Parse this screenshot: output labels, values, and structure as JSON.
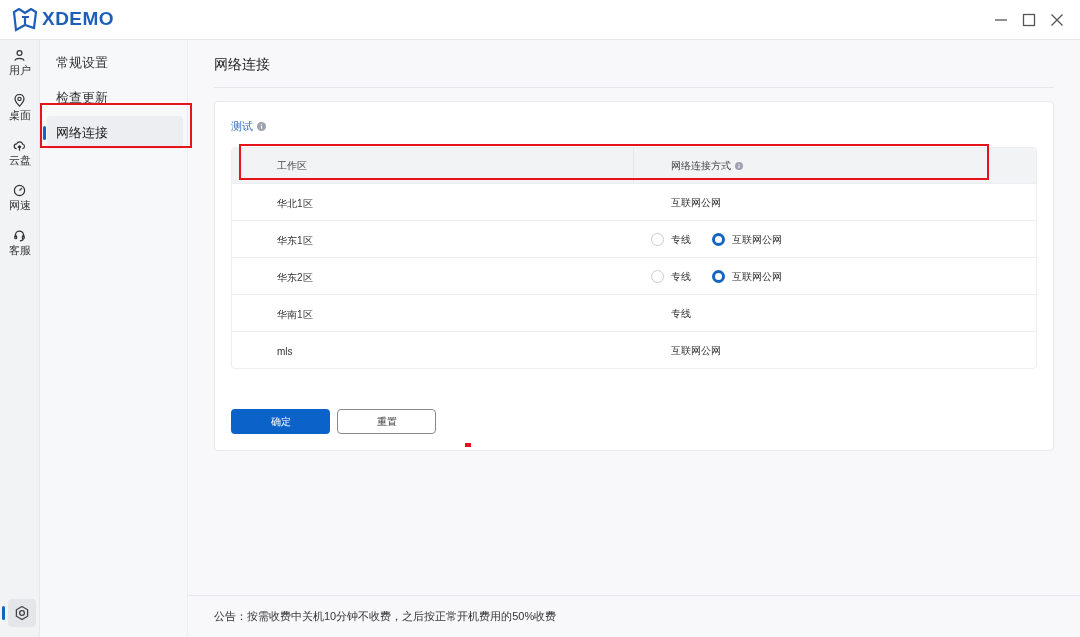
{
  "app": {
    "logo_text": "XDEMO"
  },
  "rail": {
    "items": [
      {
        "label": "用户",
        "selected": false
      },
      {
        "label": "桌面",
        "selected": false
      },
      {
        "label": "云盘",
        "selected": false
      },
      {
        "label": "网速",
        "selected": false
      },
      {
        "label": "客服",
        "selected": false
      }
    ],
    "settings": {
      "selected": true
    }
  },
  "menu": [
    {
      "label": "常规设置",
      "selected": false
    },
    {
      "label": "检查更新",
      "selected": false
    },
    {
      "label": "网络连接",
      "selected": true
    }
  ],
  "page": {
    "title": "网络连接",
    "section_label": "测试",
    "table": {
      "columns": [
        {
          "label": "工作区",
          "info": false
        },
        {
          "label": "网络连接方式",
          "info": true
        }
      ],
      "rows": [
        {
          "zone": "华北1区",
          "kind": "text",
          "value": "互联网公网"
        },
        {
          "zone": "华东1区",
          "kind": "radio",
          "options": [
            {
              "label": "专线",
              "selected": false
            },
            {
              "label": "互联网公网",
              "selected": true
            }
          ]
        },
        {
          "zone": "华东2区",
          "kind": "radio",
          "options": [
            {
              "label": "专线",
              "selected": false
            },
            {
              "label": "互联网公网",
              "selected": true
            }
          ]
        },
        {
          "zone": "华南1区",
          "kind": "text",
          "value": "专线"
        },
        {
          "zone": "mls",
          "kind": "text",
          "value": "互联网公网"
        }
      ]
    },
    "buttons": [
      {
        "label": "确定",
        "kind": "primary"
      },
      {
        "label": "重置",
        "kind": "secondary"
      }
    ]
  },
  "footer": {
    "notice": "公告：按需收费中关机10分钟不收费，之后按正常开机费用的50%收费"
  }
}
